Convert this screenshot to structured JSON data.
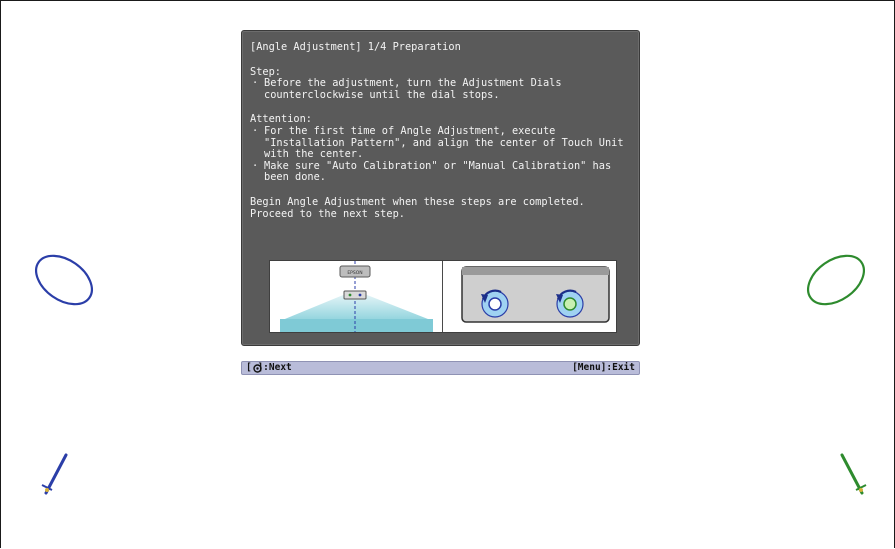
{
  "dialog": {
    "title": "[Angle Adjustment] 1/4 Preparation",
    "step_heading": "Step:",
    "step_bullets": [
      "Before the adjustment, turn the Adjustment Dials counterclockwise until the dial stops."
    ],
    "attention_heading": "Attention:",
    "attention_bullets": [
      "For the first time of Angle Adjustment, execute \"Installation Pattern\", and align the center of Touch Unit with the center.",
      "Make sure \"Auto Calibration\" or \"Manual Calibration\" has been done."
    ],
    "closing_lines": [
      "Begin Angle Adjustment when these steps are completed.",
      "Proceed to the next step."
    ],
    "projector_label": "EPSON",
    "bullet_char": "·"
  },
  "footer": {
    "next_label": "[ ]:Next",
    "exit_label": "[Menu]:Exit"
  },
  "decorations": {
    "left_shape_color": "#2b3ea8",
    "right_shape_color": "#2e8b2e",
    "left_icon": "pen-icon",
    "right_icon": "pen-icon"
  }
}
